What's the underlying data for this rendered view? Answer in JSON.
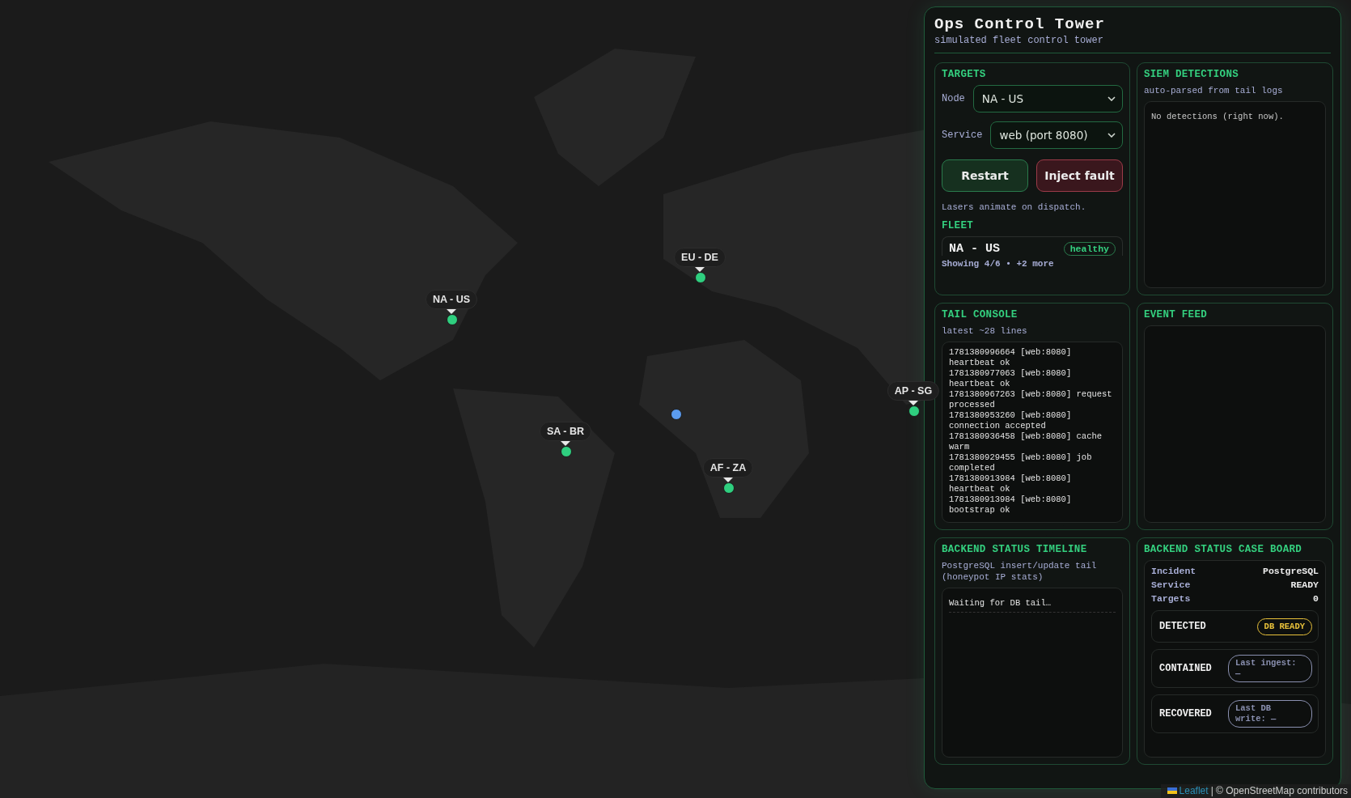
{
  "map": {
    "markers": [
      {
        "label": "NA - US",
        "color": "#2fcf7f"
      },
      {
        "label": "EU - DE",
        "color": "#2fcf7f"
      },
      {
        "label": "SA - BR",
        "color": "#2fcf7f"
      },
      {
        "label": "AF - ZA",
        "color": "#2fcf7f"
      },
      {
        "label": "AP - SG",
        "color": "#2fcf7f"
      },
      {
        "color": "#5b9cf0"
      }
    ],
    "attribution": {
      "link": "Leaflet",
      "text": "| © OpenStreetMap contributors"
    }
  },
  "panel": {
    "title": "Ops Control Tower",
    "subtitle": "simulated fleet control tower",
    "targets": {
      "heading": "TARGETS",
      "fields": [
        {
          "label": "Node",
          "value": "NA - US"
        },
        {
          "label": "Service",
          "value": "web (port 8080)"
        }
      ],
      "buttons": [
        {
          "label": "Restart",
          "kind": "primary"
        },
        {
          "label": "Inject fault",
          "kind": "danger"
        }
      ],
      "note": "Lasers animate on dispatch.",
      "fleet_heading": "FLEET",
      "fleet": [
        {
          "name": "NA - US",
          "status": "healthy"
        }
      ],
      "fleet_footer": "Showing 4/6 • +2 more"
    },
    "siem": {
      "heading": "SIEM DETECTIONS",
      "subtitle": "auto-parsed from tail logs",
      "empty": "No detections (right now)."
    },
    "tail": {
      "heading": "TAIL CONSOLE",
      "subtitle": "latest ~28 lines",
      "lines": [
        "1781380996664 [web:8080] heartbeat ok",
        "1781380977063 [web:8080] heartbeat ok",
        "1781380967263 [web:8080] request processed",
        "1781380953260 [web:8080] connection accepted",
        "1781380936458 [web:8080] cache warm",
        "1781380929455 [web:8080] job completed",
        "1781380913984 [web:8080] heartbeat ok",
        "1781380913984 [web:8080] bootstrap ok"
      ]
    },
    "events": {
      "heading": "EVENT FEED"
    },
    "timeline": {
      "heading": "BACKEND STATUS TIMELINE",
      "subtitle": "PostgreSQL insert/update tail (honeypot IP stats)",
      "empty": "Waiting for DB tail…"
    },
    "caseboard": {
      "heading": "BACKEND STATUS CASE BOARD",
      "facts": [
        {
          "key": "Incident",
          "value": "PostgreSQL"
        },
        {
          "key": "Service",
          "value": "READY"
        },
        {
          "key": "Targets",
          "value": "0"
        }
      ],
      "stages": [
        {
          "name": "DETECTED",
          "badge": "DB READY",
          "color": "#e8c13a"
        },
        {
          "name": "CONTAINED",
          "badge": "Last ingest: —",
          "color": "#8a90b0"
        },
        {
          "name": "RECOVERED",
          "badge": "Last DB write: —",
          "color": "#8a90b0"
        }
      ]
    }
  }
}
